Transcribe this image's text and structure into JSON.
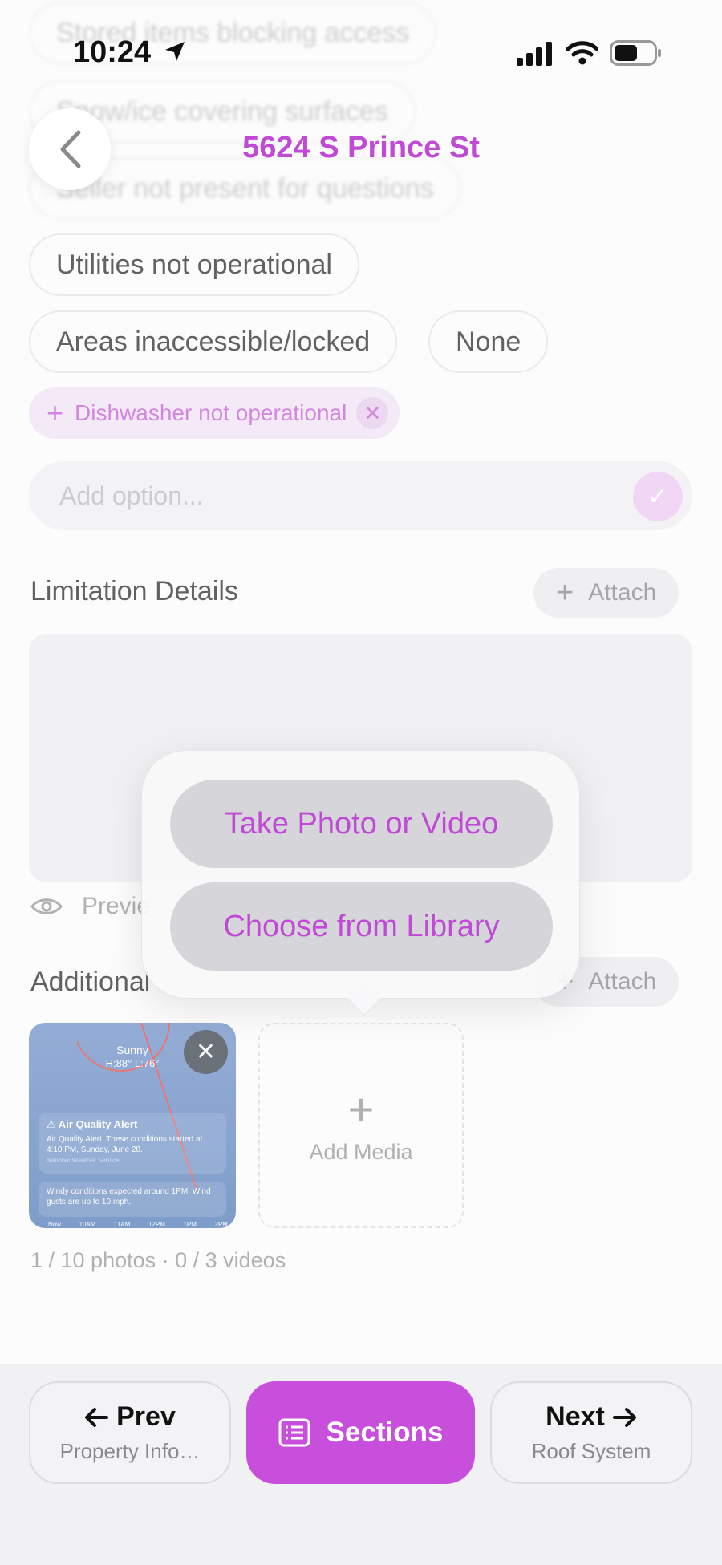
{
  "status_bar": {
    "time": "10:24"
  },
  "header": {
    "title": "5624 S Prince St"
  },
  "limitations": {
    "faded_options": [
      "Stored items blocking access",
      "Snow/ice covering surfaces",
      "Seller not present for questions"
    ],
    "options": [
      "Utilities not operational",
      "Areas inaccessible/locked",
      "None"
    ],
    "custom_option": "Dishwasher not operational",
    "add_option_placeholder": "Add option..."
  },
  "limitation_details": {
    "title": "Limitation Details",
    "attach_label": "Attach",
    "preview_label": "Previe"
  },
  "additional": {
    "title": "Additional",
    "attach_label": "Attach",
    "add_media_label": "Add Media",
    "counts": "1 / 10 photos · 0 / 3 videos",
    "thumbnail": {
      "sunny": "Sunny",
      "hilo": "H:88°  L:76°",
      "alert_title": "Air Quality Alert",
      "alert_body": "Air Quality Alert. These conditions started at 4:10 PM, Sunday, June 28.",
      "alert_source": "National Weather Service",
      "wind_text": "Windy conditions expected around 1PM. Wind gusts are up to 10 mph.",
      "hours": [
        "Now",
        "10AM",
        "11AM",
        "12PM",
        "1PM",
        "2PM"
      ]
    }
  },
  "popover": {
    "take_photo": "Take Photo or Video",
    "choose_library": "Choose from Library"
  },
  "footer": {
    "prev_label": "Prev",
    "prev_sub": "Property Info…",
    "sections_label": "Sections",
    "next_label": "Next",
    "next_sub": "Roof System"
  },
  "colors": {
    "accent": "#c84fdb",
    "accent_text": "#c04ad6"
  }
}
